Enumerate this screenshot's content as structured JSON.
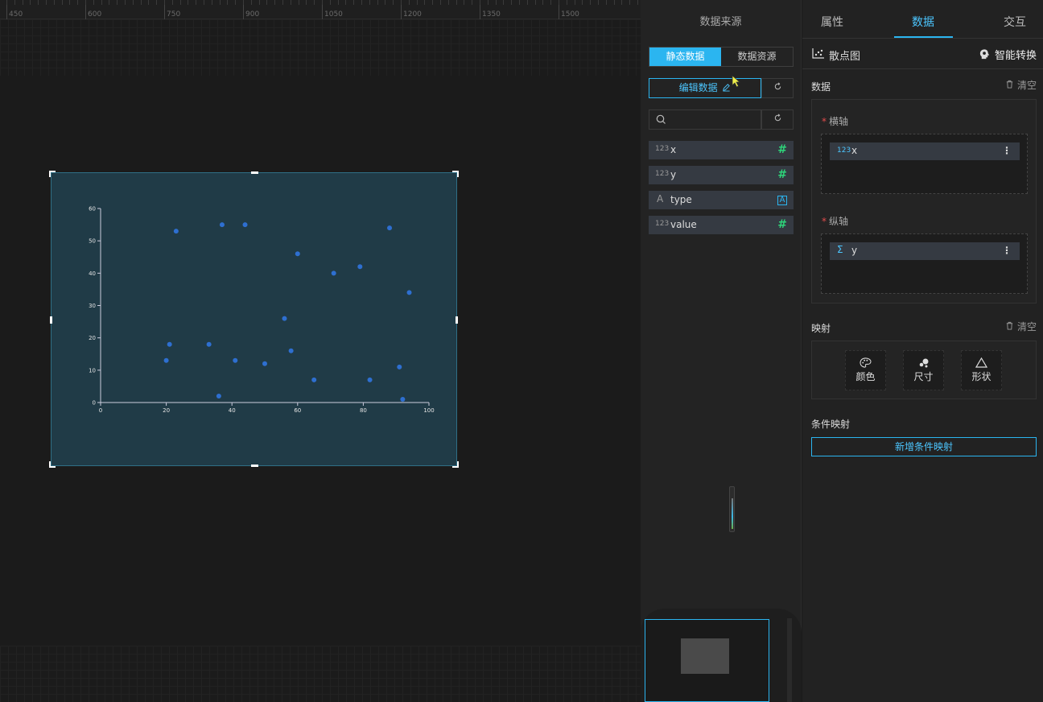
{
  "ruler": {
    "labels": [
      "450",
      "600",
      "750",
      "900",
      "1050",
      "1200",
      "1350",
      "1500"
    ]
  },
  "canvas": {
    "background": "#203b47"
  },
  "chart_data": {
    "type": "scatter",
    "title": "",
    "xlabel": "",
    "ylabel": "",
    "xlim": [
      0,
      100
    ],
    "ylim": [
      0,
      60
    ],
    "x_ticks": [
      "0",
      "20",
      "40",
      "60",
      "80",
      "100"
    ],
    "y_ticks": [
      "0",
      "10",
      "20",
      "30",
      "40",
      "50",
      "60"
    ],
    "point_color": "#2e6fd0",
    "points": [
      {
        "x": 20,
        "y": 13
      },
      {
        "x": 21,
        "y": 18
      },
      {
        "x": 23,
        "y": 53
      },
      {
        "x": 33,
        "y": 18
      },
      {
        "x": 36,
        "y": 2
      },
      {
        "x": 37,
        "y": 55
      },
      {
        "x": 41,
        "y": 13
      },
      {
        "x": 44,
        "y": 55
      },
      {
        "x": 50,
        "y": 12
      },
      {
        "x": 56,
        "y": 26
      },
      {
        "x": 58,
        "y": 16
      },
      {
        "x": 60,
        "y": 46
      },
      {
        "x": 65,
        "y": 7
      },
      {
        "x": 71,
        "y": 40
      },
      {
        "x": 79,
        "y": 42
      },
      {
        "x": 82,
        "y": 7
      },
      {
        "x": 88,
        "y": 54
      },
      {
        "x": 91,
        "y": 11
      },
      {
        "x": 92,
        "y": 1
      },
      {
        "x": 94,
        "y": 34
      }
    ]
  },
  "source": {
    "title": "数据来源",
    "static_tab": "静态数据",
    "resource_tab": "数据资源",
    "edit_label": "编辑数据",
    "search_placeholder": "",
    "fields": [
      {
        "type_label": "123",
        "name": "x",
        "kind": "number"
      },
      {
        "type_label": "123",
        "name": "y",
        "kind": "number"
      },
      {
        "type_label": "A",
        "name": "type",
        "kind": "text"
      },
      {
        "type_label": "123",
        "name": "value",
        "kind": "number"
      }
    ]
  },
  "right": {
    "tabs": [
      "属性",
      "数据",
      "交互"
    ],
    "chart_type": "散点图",
    "smart_convert": "智能转换",
    "data_section": "数据",
    "clear": "清空",
    "x_axis_label": "横轴",
    "x_chip_type": "123",
    "x_chip_name": "x",
    "y_axis_label": "纵轴",
    "y_chip_type": "Σ",
    "y_chip_name": "y",
    "mapping_section": "映射",
    "mapping_clear": "清空",
    "mapping_color": "颜色",
    "mapping_size": "尺寸",
    "mapping_shape": "形状",
    "condition_section": "条件映射",
    "add_condition": "新增条件映射"
  },
  "colors": {
    "accent": "#2bb5f0",
    "number_badge": "#2ed47a"
  }
}
